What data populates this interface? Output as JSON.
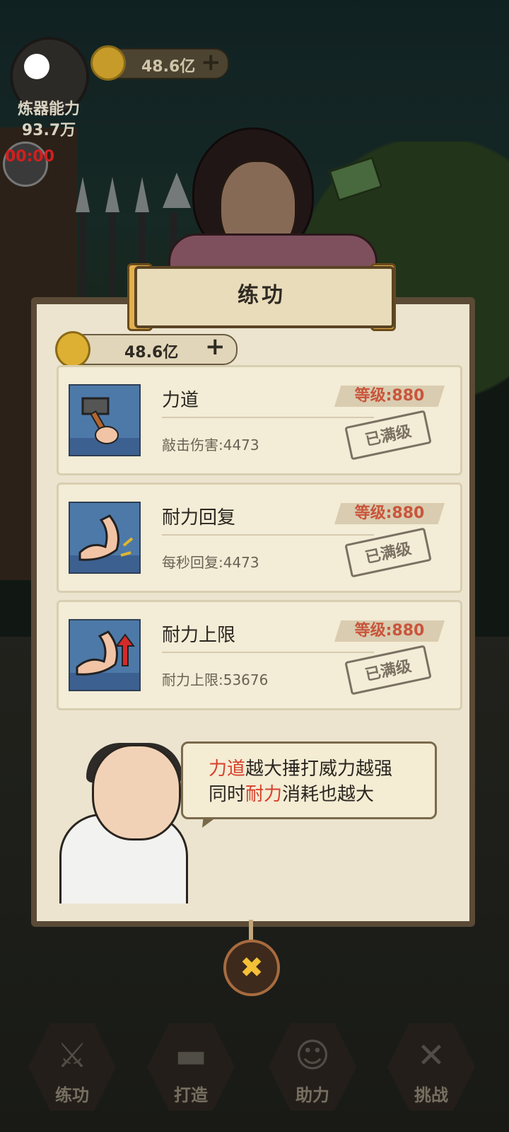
{
  "hud": {
    "power_label": "炼器能力",
    "power_value": "93.7万",
    "timer": "00:00",
    "currency_amount": "48.6亿",
    "plus": "+"
  },
  "panel": {
    "title": "练功",
    "currency_amount": "48.6亿",
    "plus": "+",
    "upgrades": [
      {
        "name": "力道",
        "level": "等级:880",
        "stat": "敲击伤害:4473",
        "status": "已满级",
        "icon": "hammer-icon"
      },
      {
        "name": "耐力回复",
        "level": "等级:880",
        "stat": "每秒回复:4473",
        "status": "已满级",
        "icon": "flex-arm-icon"
      },
      {
        "name": "耐力上限",
        "level": "等级:880",
        "stat": "耐力上限:53676",
        "status": "已满级",
        "icon": "arm-up-icon"
      }
    ],
    "tip": {
      "line1_red": "力道",
      "line1_rest": "越大捶打威力越强",
      "line2_a": "同时",
      "line2_red": "耐力",
      "line2_b": "消耗也越大"
    },
    "close_glyph": "✖"
  },
  "nav": [
    {
      "label": "练功",
      "icon": "sword-icon"
    },
    {
      "label": "打造",
      "icon": "anvil-icon"
    },
    {
      "label": "助力",
      "icon": "helper-icon"
    },
    {
      "label": "挑战",
      "icon": "crossed-swords-icon"
    }
  ],
  "colors": {
    "level_text": "#c9553b",
    "highlight": "#d6402c",
    "panel_bg": "#ece4cf"
  }
}
